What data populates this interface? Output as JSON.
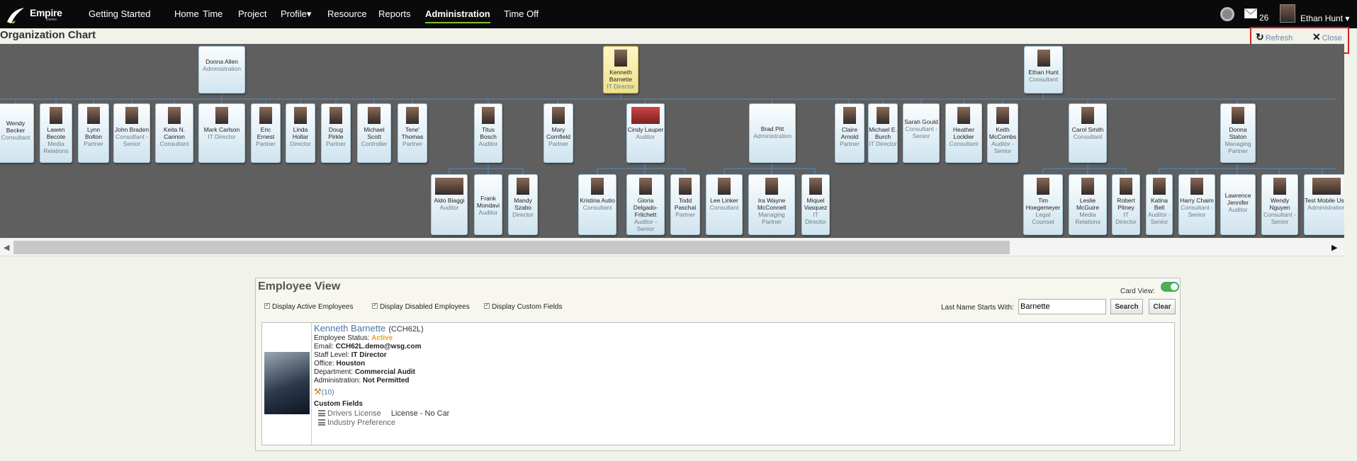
{
  "nav": {
    "logo_text": "Empire",
    "logo_sub": "Demo",
    "items": [
      "Getting Started",
      "Home",
      "Time",
      "Project",
      "Profile▾",
      "Resource",
      "Reports",
      "Administration",
      "Time Off"
    ],
    "mail_count": "26",
    "user_name": "Ethan Hunt ▾"
  },
  "org": {
    "title": "Organization Chart",
    "refresh_label": "Refresh",
    "close_label": "Close",
    "nodes": [
      {
        "name": "Donna Allen",
        "title": "Administration",
        "photo": false
      },
      {
        "name": "Kenneth Barnette",
        "title": "IT Director",
        "photo": true,
        "selected": true
      },
      {
        "name": "Ethan Hunt",
        "title": "Consultant",
        "photo": true
      },
      {
        "name": "Wendy Becker",
        "title": "Consultant",
        "photo": false
      },
      {
        "name": "Lawen Becote",
        "title": "Media Relations",
        "photo": true
      },
      {
        "name": "Lynn Bolton",
        "title": "Partner",
        "photo": true
      },
      {
        "name": "John Braden",
        "title": "Consultant - Senior",
        "photo": true
      },
      {
        "name": "Keita N. Cannon",
        "title": "Consultant",
        "photo": true
      },
      {
        "name": "Mark Carlson",
        "title": "IT Director",
        "photo": true
      },
      {
        "name": "Eric Ernest",
        "title": "Partner",
        "photo": true
      },
      {
        "name": "Linda Hollar",
        "title": "Director",
        "photo": true
      },
      {
        "name": "Doug Pirkle",
        "title": "Partner",
        "photo": true
      },
      {
        "name": "Michael Scott",
        "title": "Controller",
        "photo": true
      },
      {
        "name": "Tene' Thomas",
        "title": "Partner",
        "photo": true
      },
      {
        "name": "Titus Bosch",
        "title": "Auditor",
        "photo": true
      },
      {
        "name": "Mary Cornfield",
        "title": "Partner",
        "photo": true
      },
      {
        "name": "Cindy Lauper",
        "title": "Auditor",
        "photo": true
      },
      {
        "name": "Brad Pitt",
        "title": "Administration",
        "photo": false
      },
      {
        "name": "Claire Arnold",
        "title": "Partner",
        "photo": true
      },
      {
        "name": "Michael E. Burch",
        "title": "IT Director",
        "photo": true
      },
      {
        "name": "Sarah Gould",
        "title": "Consultant - Senior",
        "photo": false
      },
      {
        "name": "Heather Locklier",
        "title": "Consultant",
        "photo": true
      },
      {
        "name": "Keith McCombs",
        "title": "Auditor - Senior",
        "photo": true
      },
      {
        "name": "Carol Smith",
        "title": "Consultant",
        "photo": true
      },
      {
        "name": "Donna Staton",
        "title": "Managing Partner",
        "photo": true
      },
      {
        "name": "Aldo Biaggi",
        "title": "Auditor",
        "photo": true
      },
      {
        "name": "Frank Mondavi",
        "title": "Auditor",
        "photo": false
      },
      {
        "name": "Mandy Szabo",
        "title": "Director",
        "photo": true
      },
      {
        "name": "Kristina Autio",
        "title": "Consultant",
        "photo": true
      },
      {
        "name": "Gloria Delgado-Fritchett",
        "title": "Auditor - Senior",
        "photo": true
      },
      {
        "name": "Todd Paschal",
        "title": "Partner",
        "photo": true
      },
      {
        "name": "Lee Linker",
        "title": "Consultant",
        "photo": true
      },
      {
        "name": "Ira Wayne McConnell",
        "title": "Managing Partner",
        "photo": true
      },
      {
        "name": "Miquel Vasquez",
        "title": "IT Director",
        "photo": true
      },
      {
        "name": "Tim Hoegemeyer",
        "title": "Legal Counsel",
        "photo": true
      },
      {
        "name": "Leslie McGuire",
        "title": "Media Relations",
        "photo": true
      },
      {
        "name": "Robert Pitney",
        "title": "IT Director",
        "photo": true
      },
      {
        "name": "Katina Bell",
        "title": "Auditor - Senior",
        "photo": true
      },
      {
        "name": "Harry Chaim",
        "title": "Consultant - Senior",
        "photo": true
      },
      {
        "name": "Lawrence Jennifer",
        "title": "Auditor",
        "photo": false
      },
      {
        "name": "Wendy Nguyen",
        "title": "Consultant - Senior",
        "photo": true
      },
      {
        "name": "Test Mobile User",
        "title": "Administration",
        "photo": true
      }
    ]
  },
  "employee_view": {
    "title": "Employee View",
    "card_view_label": "Card View:",
    "chk_active": "Display Active Employees",
    "chk_disabled": "Display Disabled Employees",
    "chk_custom": "Display Custom Fields",
    "last_name_label": "Last Name Starts With:",
    "last_name_value": "Barnette",
    "search_label": "Search",
    "clear_label": "Clear",
    "employee": {
      "name": "Kenneth Barnette",
      "code": "(CCH62L)",
      "status_label": "Employee Status:",
      "status": "Active",
      "email_label": "Email:",
      "email": "CCH62L.demo@wsg.com",
      "staff_label": "Staff Level:",
      "staff": "IT Director",
      "office_label": "Office:",
      "office": "Houston",
      "dept_label": "Department:",
      "dept": "Commercial Audit",
      "admin_label": "Administration:",
      "admin": "Not Permitted",
      "count": "(10)",
      "custom_fields_title": "Custom Fields",
      "cf1_label": "Drivers License",
      "cf1_value": "License - No Car",
      "cf2_label": "Industry Preference"
    }
  }
}
